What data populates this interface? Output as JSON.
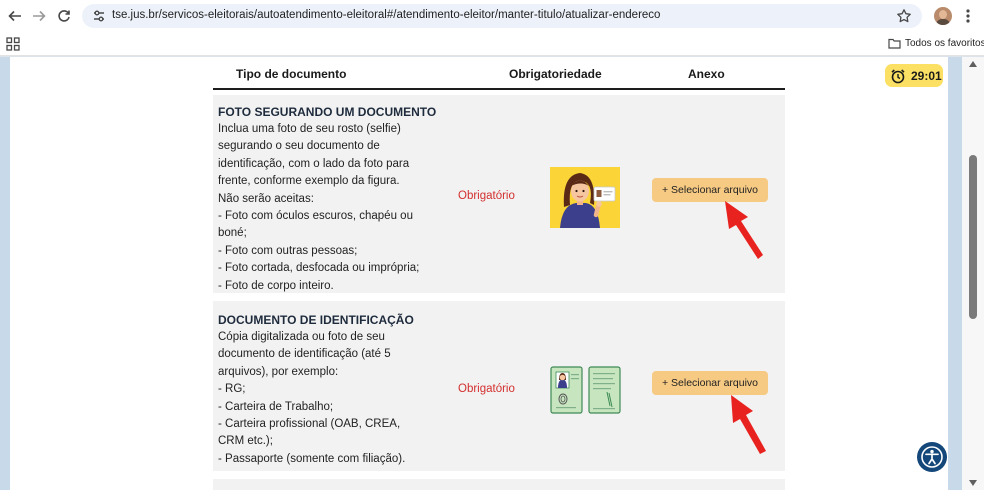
{
  "browser": {
    "url": "tse.jus.br/servicos-eleitorais/autoatendimento-eleitoral#/atendimento-eleitor/manter-titulo/atualizar-endereco",
    "bookmarks_folder": "Todos os favoritos"
  },
  "timer": {
    "value": "29:01"
  },
  "table": {
    "headers": {
      "doc": "Tipo de documento",
      "req": "Obrigatoriedade",
      "attach": "Anexo"
    },
    "rows": [
      {
        "title": "FOTO SEGURANDO UM DOCUMENTO",
        "lines": [
          "Inclua uma foto de seu rosto (selfie)",
          "segurando o seu documento de",
          "identificação, com o lado da foto para",
          "frente, conforme exemplo da figura.",
          "Não serão aceitas:",
          "- Foto com óculos escuros, chapéu ou",
          "boné;",
          "- Foto com outras pessoas;",
          "- Foto cortada, desfocada ou imprópria;",
          "- Foto de corpo inteiro."
        ],
        "requirement": "Obrigatório",
        "button": "+ Selecionar arquivo"
      },
      {
        "title": "DOCUMENTO DE IDENTIFICAÇÃO",
        "lines": [
          "Cópia digitalizada ou foto de seu",
          "documento de identificação (até 5",
          "arquivos), por exemplo:",
          "- RG;",
          "- Carteira de Trabalho;",
          "- Carteira profissional (OAB, CREA,",
          "CRM etc.);",
          "- Passaporte (somente com filiação)."
        ],
        "requirement": "Obrigatório",
        "button": "+ Selecionar arquivo"
      }
    ]
  },
  "colors": {
    "accent_button": "#f7ca83",
    "required_text": "#d32f2f",
    "timer_bg": "#fbe064",
    "annotation_arrow": "#e8231f"
  }
}
